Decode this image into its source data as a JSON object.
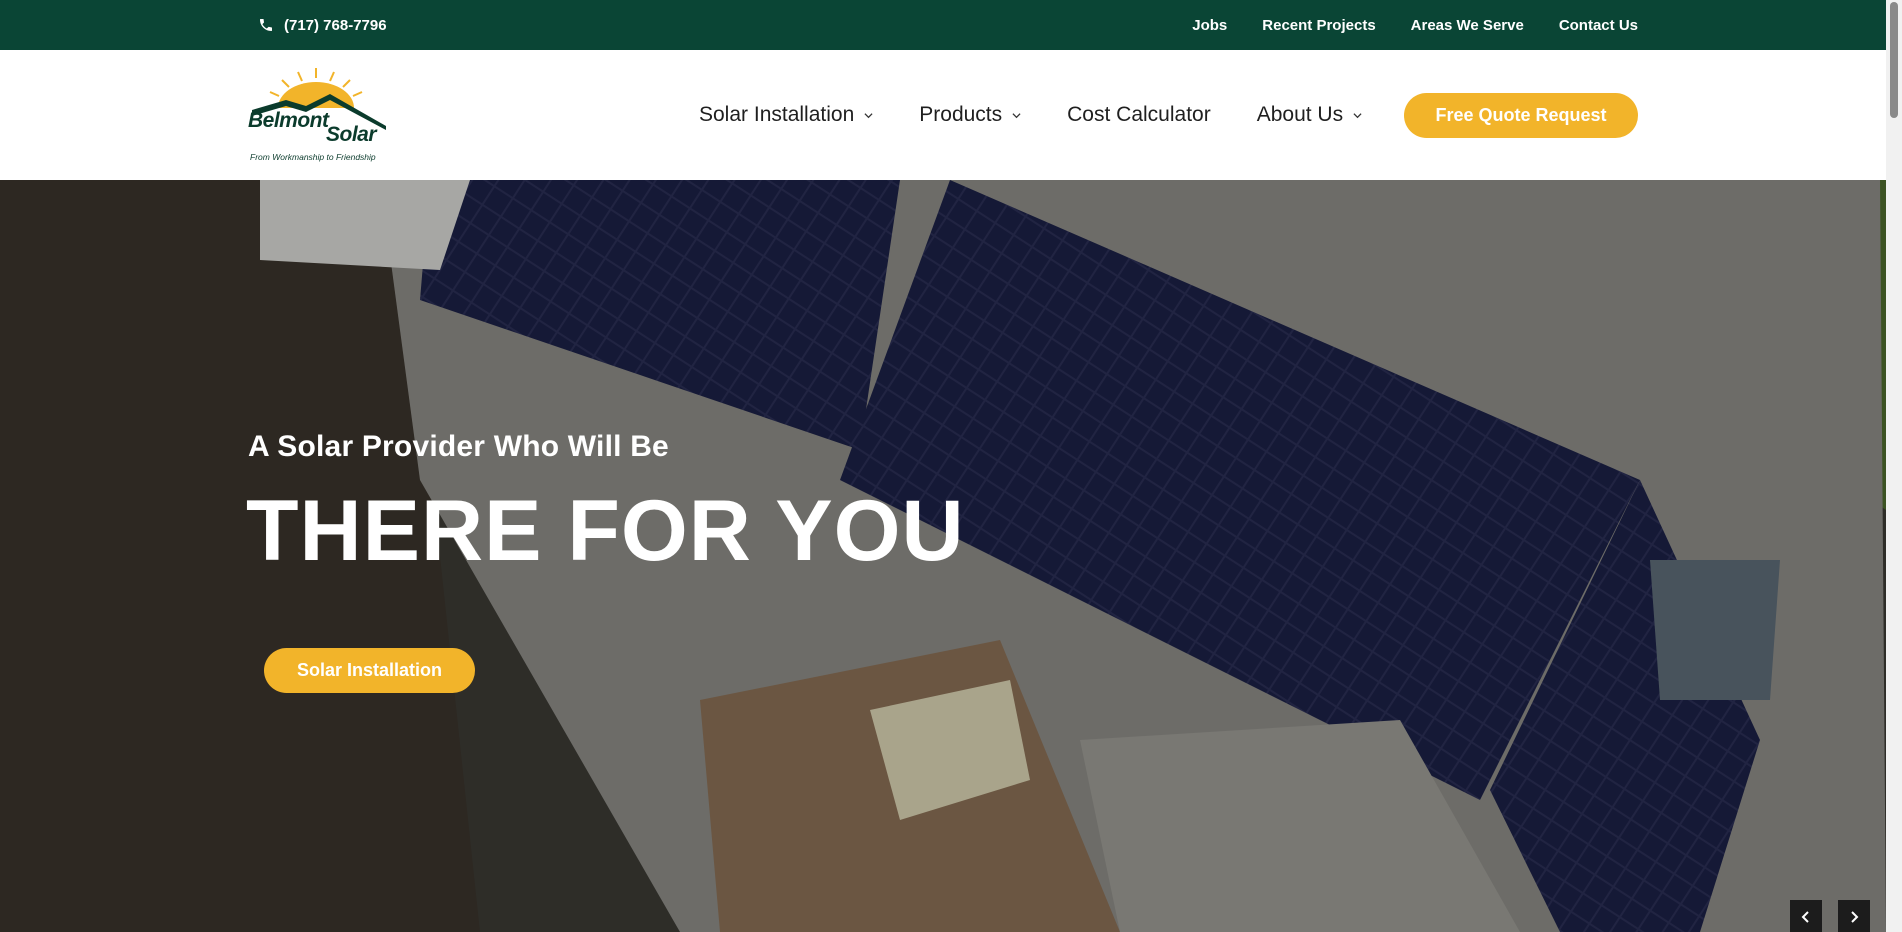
{
  "topbar": {
    "phone_icon": "phone-icon",
    "phone": "(717) 768-7796",
    "links": [
      "Jobs",
      "Recent Projects",
      "Areas We Serve",
      "Contact Us"
    ]
  },
  "logo": {
    "brand_first": "Belmont",
    "brand_second": "Solar",
    "tagline": "From Workmanship to Friendship"
  },
  "nav": {
    "items": [
      {
        "label": "Solar Installation",
        "has_dropdown": true
      },
      {
        "label": "Products",
        "has_dropdown": true
      },
      {
        "label": "Cost Calculator",
        "has_dropdown": false
      },
      {
        "label": "About Us",
        "has_dropdown": true
      }
    ],
    "cta_label": "Free Quote Request"
  },
  "hero": {
    "subtitle": "A Solar Provider Who Will Be",
    "headline": "THERE FOR YOU",
    "button_label": "Solar Installation"
  },
  "colors": {
    "topbar_bg": "#0a4535",
    "accent": "#f2b42a",
    "brand_green": "#0b3b2c"
  }
}
